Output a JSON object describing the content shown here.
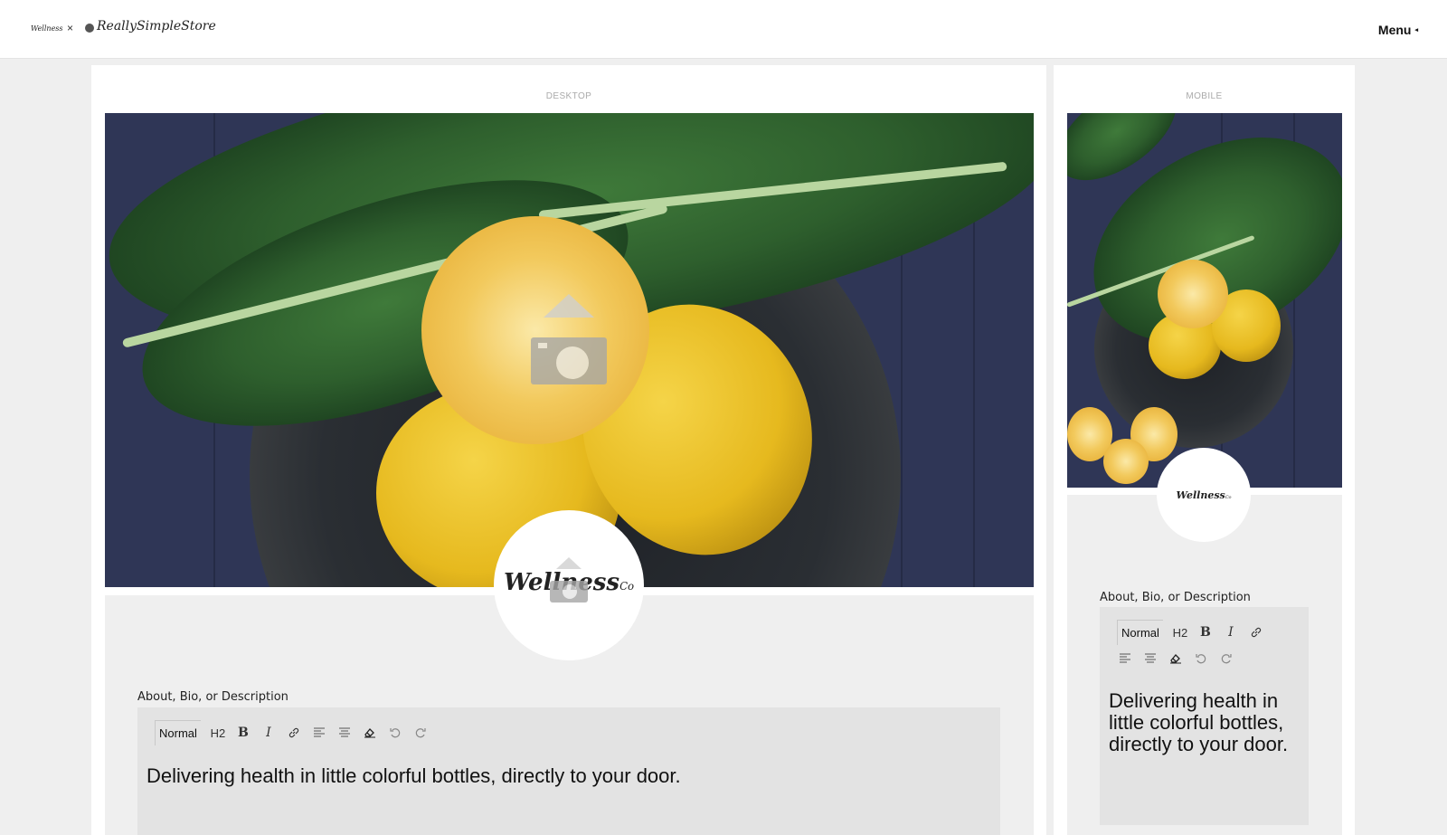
{
  "header": {
    "brand_small": "Wellness",
    "separator": "×",
    "brand_name": "ReallySimpleStore",
    "menu_label": "Menu",
    "menu_caret": "◂"
  },
  "desktop": {
    "label": "DESKTOP",
    "profile_logo": "Wellness",
    "profile_logo_co": "Co",
    "field_label": "About, Bio, or Description",
    "editor_text": "Delivering health in little colorful bottles, directly to your door."
  },
  "mobile": {
    "label": "MOBILE",
    "profile_logo": "Wellness",
    "profile_logo_co": "Co",
    "field_label": "About, Bio, or Description",
    "editor_text": "Delivering health in little colorful bottles, directly to your door."
  },
  "toolbar": {
    "format_select": "Normal",
    "heading": "H2",
    "bold": "B",
    "italic": "I",
    "icons": [
      "link-icon",
      "align-left-icon",
      "align-center-icon",
      "eraser-icon",
      "undo-icon",
      "redo-icon"
    ]
  },
  "colors": {
    "page_bg": "#efefef",
    "editor_bg": "#e3e3e3",
    "hero_bg": "#2f3656",
    "lemon": "#e6b91e",
    "kale": "#2e5f2d"
  }
}
